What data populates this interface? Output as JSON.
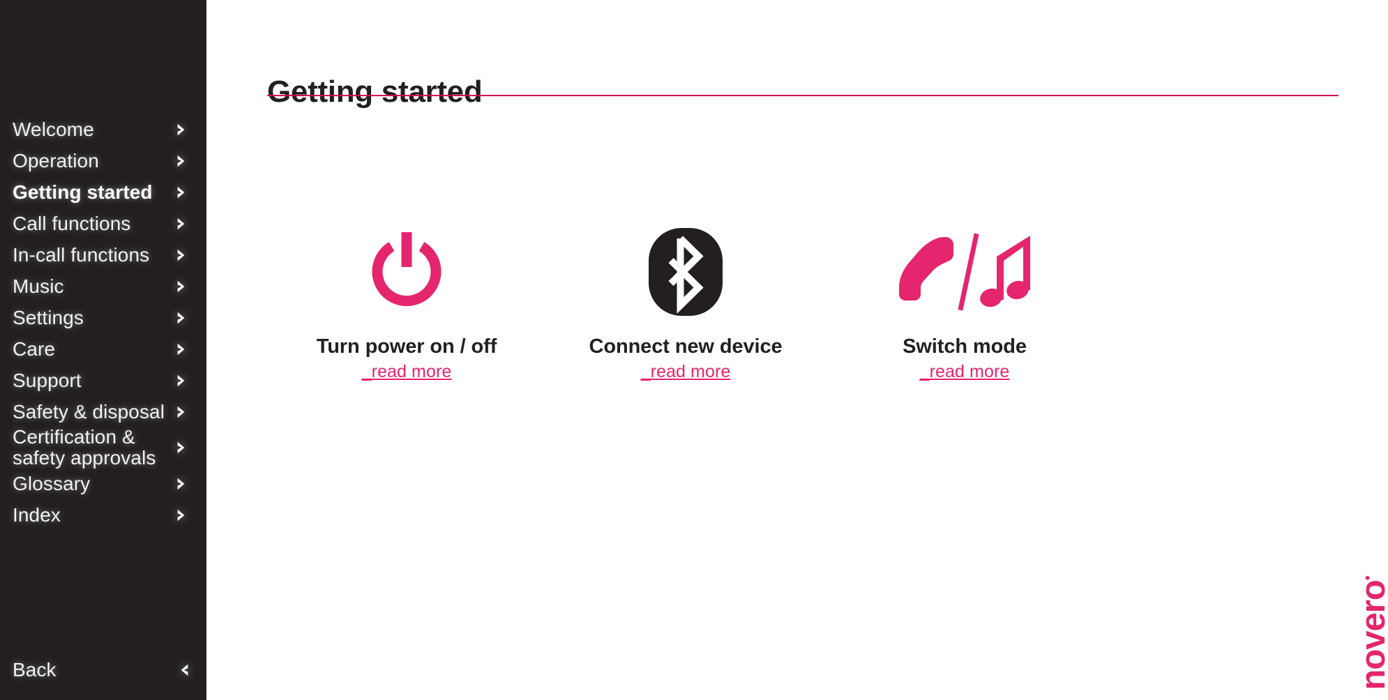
{
  "sidebar": {
    "items": [
      {
        "label": "Welcome",
        "icon": "chevron-right-icon",
        "active": false,
        "two_line": false
      },
      {
        "label": "Operation",
        "icon": "chevron-right-icon",
        "active": false,
        "two_line": false
      },
      {
        "label": "Getting started",
        "icon": "chevron-right-icon",
        "active": true,
        "two_line": false
      },
      {
        "label": "Call functions",
        "icon": "chevron-right-icon",
        "active": false,
        "two_line": false
      },
      {
        "label": "In-call functions",
        "icon": "chevron-right-icon",
        "active": false,
        "two_line": false
      },
      {
        "label": "Music",
        "icon": "chevron-right-icon",
        "active": false,
        "two_line": false
      },
      {
        "label": "Settings",
        "icon": "chevron-right-icon",
        "active": false,
        "two_line": false
      },
      {
        "label": "Care",
        "icon": "chevron-right-icon",
        "active": false,
        "two_line": false
      },
      {
        "label": "Support",
        "icon": "chevron-right-icon",
        "active": false,
        "two_line": false
      },
      {
        "label": "Safety & disposal",
        "icon": "chevron-right-icon",
        "active": false,
        "two_line": false
      },
      {
        "label": "Certification &\nsafety approvals",
        "icon": "chevron-right-icon",
        "active": false,
        "two_line": true
      },
      {
        "label": "Glossary",
        "icon": "chevron-right-icon",
        "active": false,
        "two_line": false
      },
      {
        "label": "Index",
        "icon": "chevron-right-icon",
        "active": false,
        "two_line": false
      }
    ],
    "back": {
      "label": "Back",
      "icon": "chevron-left-icon"
    },
    "background_color": "#231f20"
  },
  "main": {
    "title": "Getting started",
    "rule_color": "#d4005a",
    "cards": [
      {
        "icon": "power-icon",
        "title": "Turn power on / off",
        "link_label": "_read more"
      },
      {
        "icon": "bluetooth-icon",
        "title": "Connect new device",
        "link_label": "_read more"
      },
      {
        "icon": "phone-music-switch-icon",
        "title": "Switch mode",
        "link_label": "_read more"
      }
    ]
  },
  "brand": {
    "name": "novero",
    "mark": "•",
    "color": "#e5256e"
  },
  "colors": {
    "accent_pink": "#e5256e",
    "rule_pink": "#d4005a",
    "sidebar_dark": "#231f20",
    "text_dark": "#231f20",
    "text_light": "#f2f2f2"
  }
}
